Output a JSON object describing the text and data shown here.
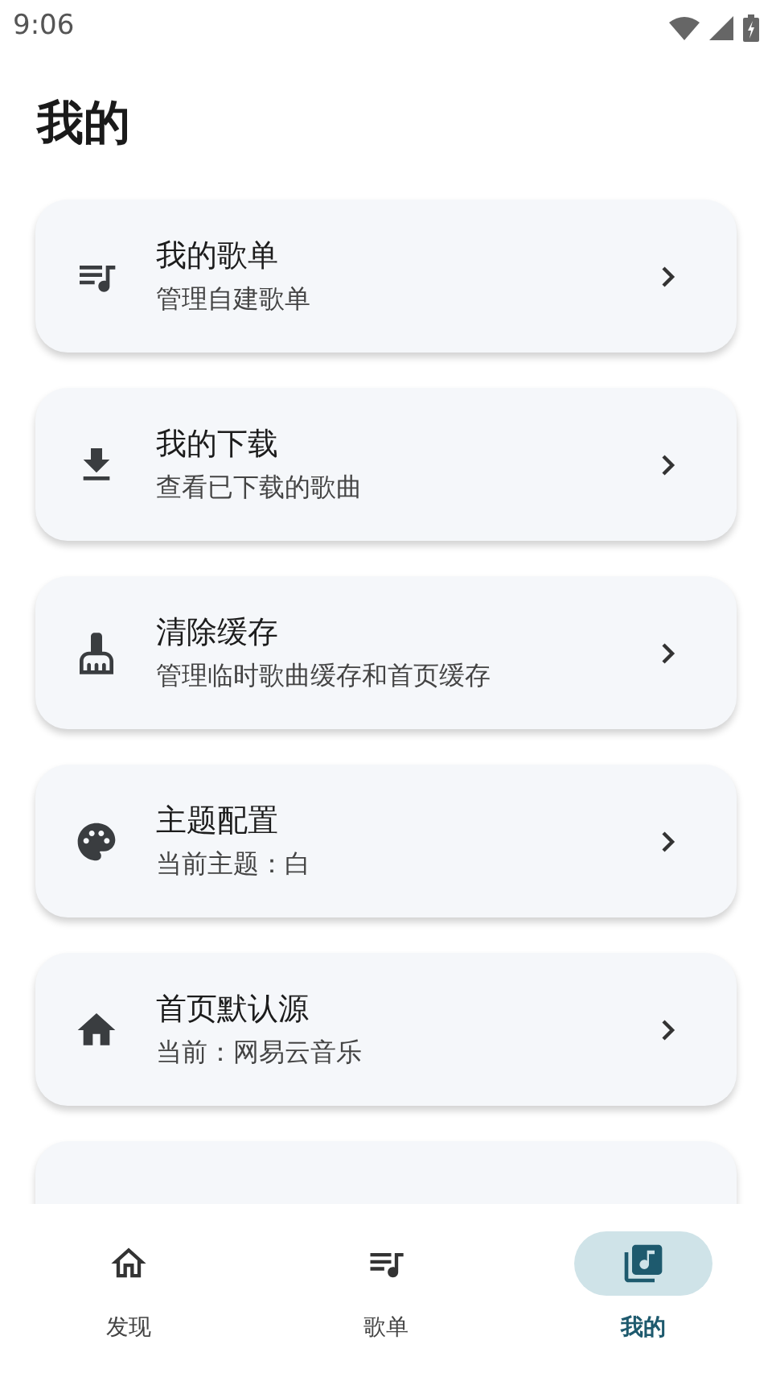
{
  "status_bar": {
    "time": "9:06"
  },
  "title": "我的",
  "settings": [
    {
      "title": "我的歌单",
      "subtitle": "管理自建歌单"
    },
    {
      "title": "我的下载",
      "subtitle": "查看已下载的歌曲"
    },
    {
      "title": "清除缓存",
      "subtitle": "管理临时歌曲缓存和首页缓存"
    },
    {
      "title": "主题配置",
      "subtitle": "当前主题：白"
    },
    {
      "title": "首页默认源",
      "subtitle": "当前：网易云音乐"
    }
  ],
  "more_below": true,
  "bottom_nav": [
    {
      "label": "发现",
      "selected": false
    },
    {
      "label": "歌单",
      "selected": false
    },
    {
      "label": "我的",
      "selected": true
    }
  ]
}
